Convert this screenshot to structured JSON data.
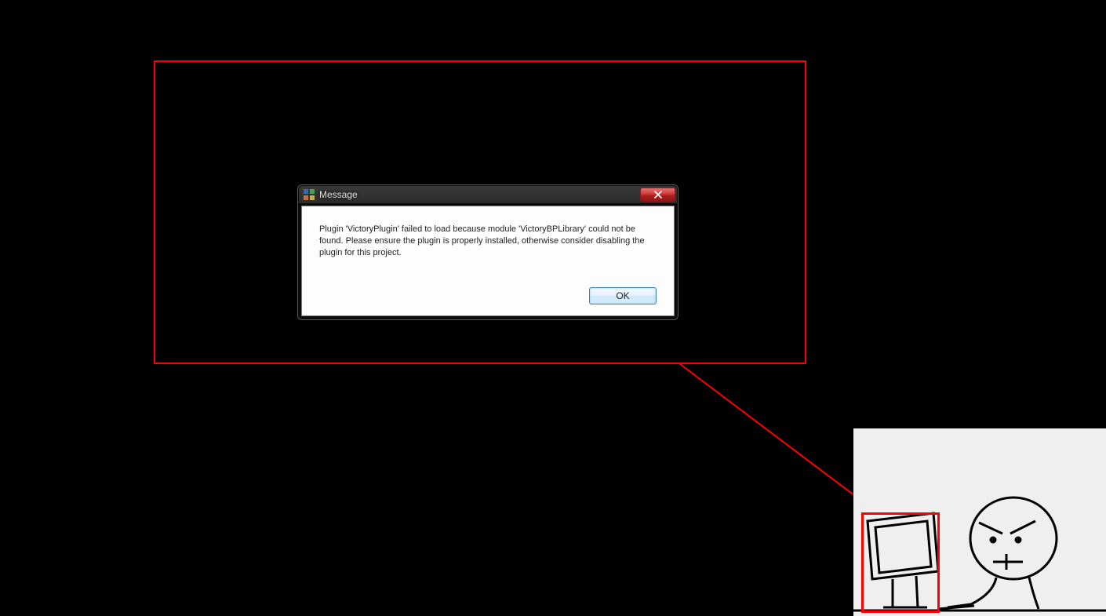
{
  "dialog": {
    "title": "Message",
    "message": "Plugin 'VictoryPlugin' failed to load because module 'VictoryBPLibrary' could not be found.  Please ensure the plugin is properly installed, otherwise consider disabling the plugin for this project.",
    "ok_label": "OK"
  }
}
